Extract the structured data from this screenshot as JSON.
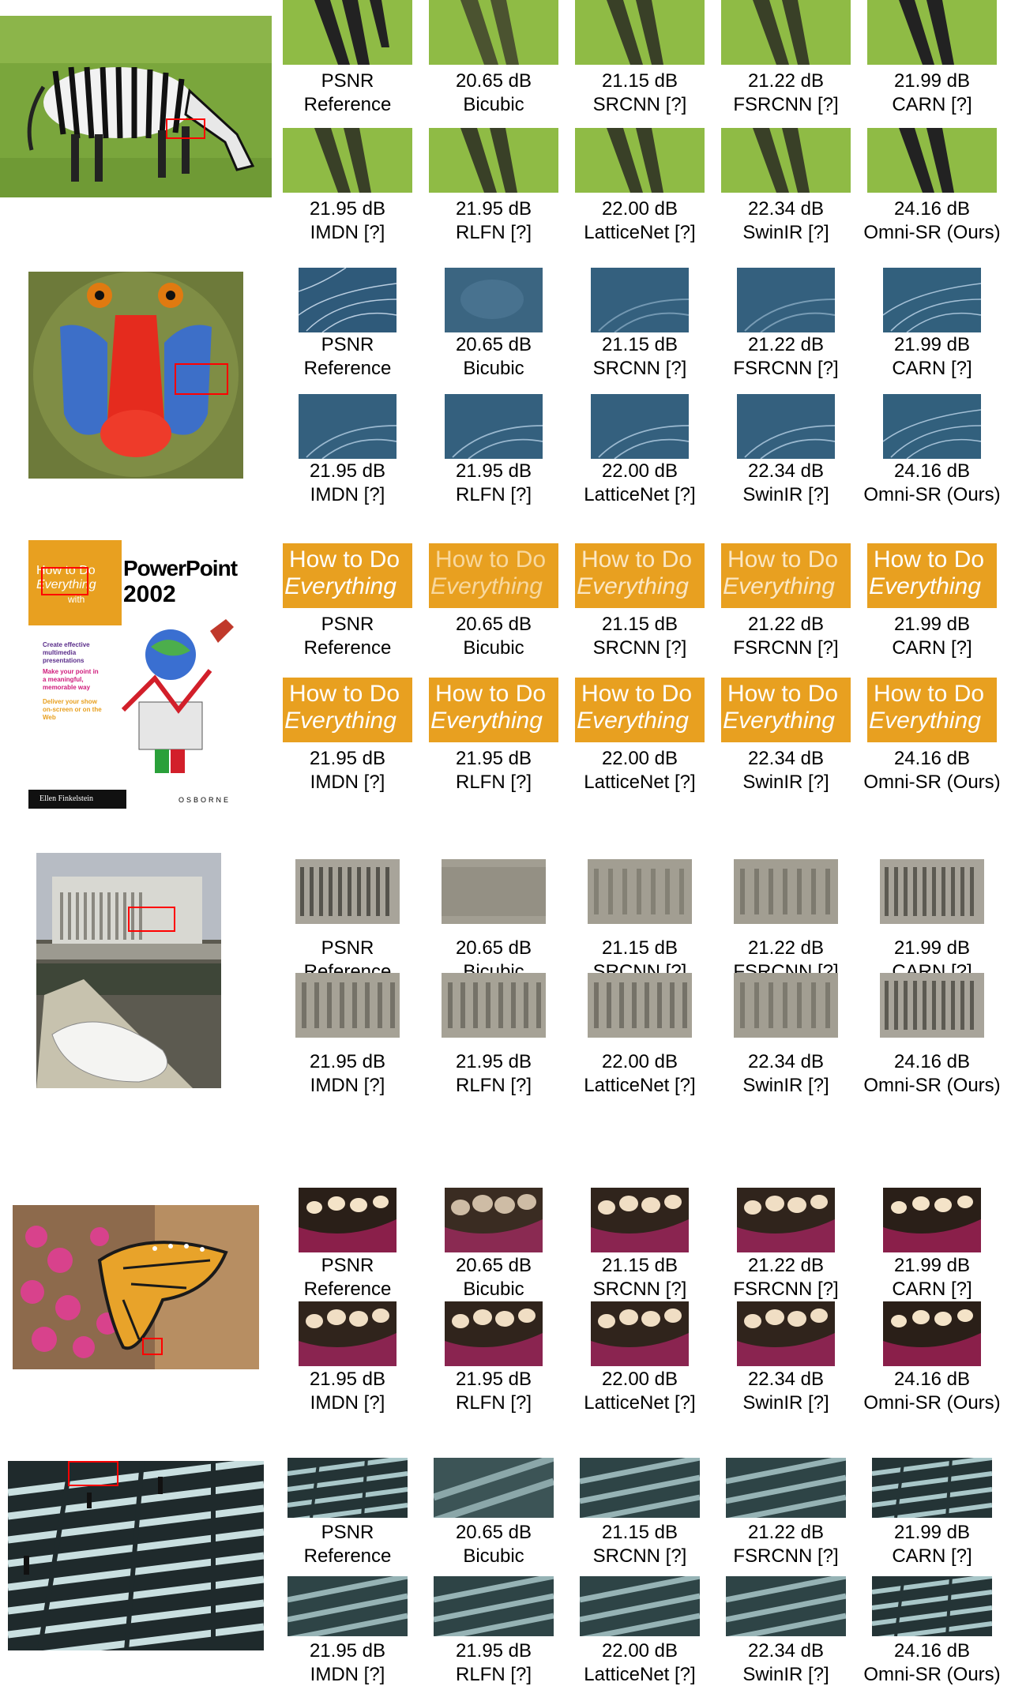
{
  "methods": [
    {
      "psnr": "PSNR",
      "name": "Reference"
    },
    {
      "psnr": "20.65 dB",
      "name": "Bicubic"
    },
    {
      "psnr": "21.15 dB",
      "name": "SRCNN [?]"
    },
    {
      "psnr": "21.22 dB",
      "name": "FSRCNN [?]"
    },
    {
      "psnr": "21.99 dB",
      "name": "CARN [?]"
    },
    {
      "psnr": "21.95 dB",
      "name": "IMDN [?]"
    },
    {
      "psnr": "21.95 dB",
      "name": "RLFN [?]"
    },
    {
      "psnr": "22.00 dB",
      "name": "LatticeNet [?]"
    },
    {
      "psnr": "22.34 dB",
      "name": "SwinIR [?]"
    },
    {
      "psnr": "24.16 dB",
      "name": "Omni-SR (Ours)"
    }
  ],
  "cover": {
    "title_line1": "How to Do",
    "title_line2": "Everything",
    "title_line3": "with",
    "product": "PowerPoint",
    "year": "2002",
    "bullet1": "Create effective multimedia presentations",
    "bullet2": "Make your point in a meaningful, memorable way",
    "bullet3": "Deliver your show on-screen or on the Web",
    "author": "Ellen Finkelstein",
    "publisher": "OSBORNE"
  },
  "colors": {
    "marker": "#ff0000",
    "grass": "#79a83a",
    "cover_orange": "#e8a020"
  }
}
